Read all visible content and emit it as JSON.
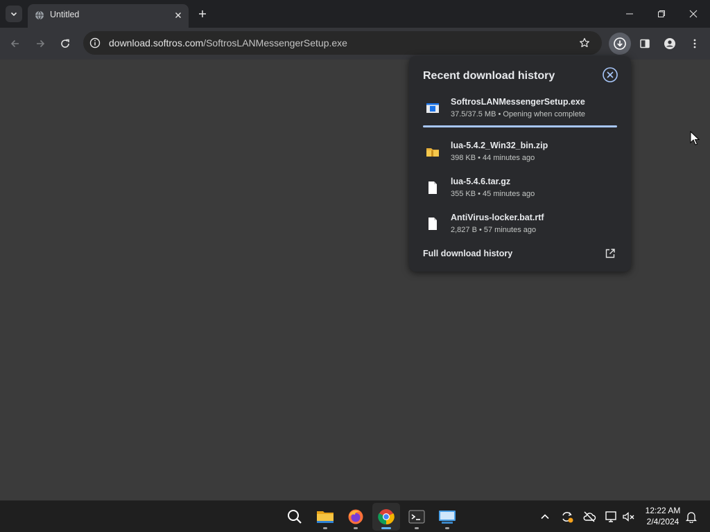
{
  "browser": {
    "tab_title": "Untitled",
    "url_host": "download.softros.com",
    "url_path": "/SoftrosLANMessengerSetup.exe"
  },
  "downloads": {
    "title": "Recent download history",
    "items": [
      {
        "name": "SoftrosLANMessengerSetup.exe",
        "meta": "37.5/37.5 MB • Opening when complete",
        "icon": "installer-icon",
        "progress": 1.0
      },
      {
        "name": "lua-5.4.2_Win32_bin.zip",
        "meta": "398 KB • 44 minutes ago",
        "icon": "zip-folder-icon"
      },
      {
        "name": "lua-5.4.6.tar.gz",
        "meta": "355 KB • 45 minutes ago",
        "icon": "file-icon"
      },
      {
        "name": "AntiVirus-locker.bat.rtf",
        "meta": "2,827 B • 57 minutes ago",
        "icon": "file-icon"
      }
    ],
    "footer": "Full download history"
  },
  "taskbar": {
    "apps": [
      "search-icon",
      "file-explorer-icon",
      "firefox-icon",
      "chrome-icon",
      "terminal-icon",
      "remote-desktop-icon"
    ],
    "time": "12:22 AM",
    "date": "2/4/2024"
  },
  "colors": {
    "accent": "#a8c7fa",
    "page_bg": "#3b3b3b",
    "panel_bg": "#292a2d"
  }
}
